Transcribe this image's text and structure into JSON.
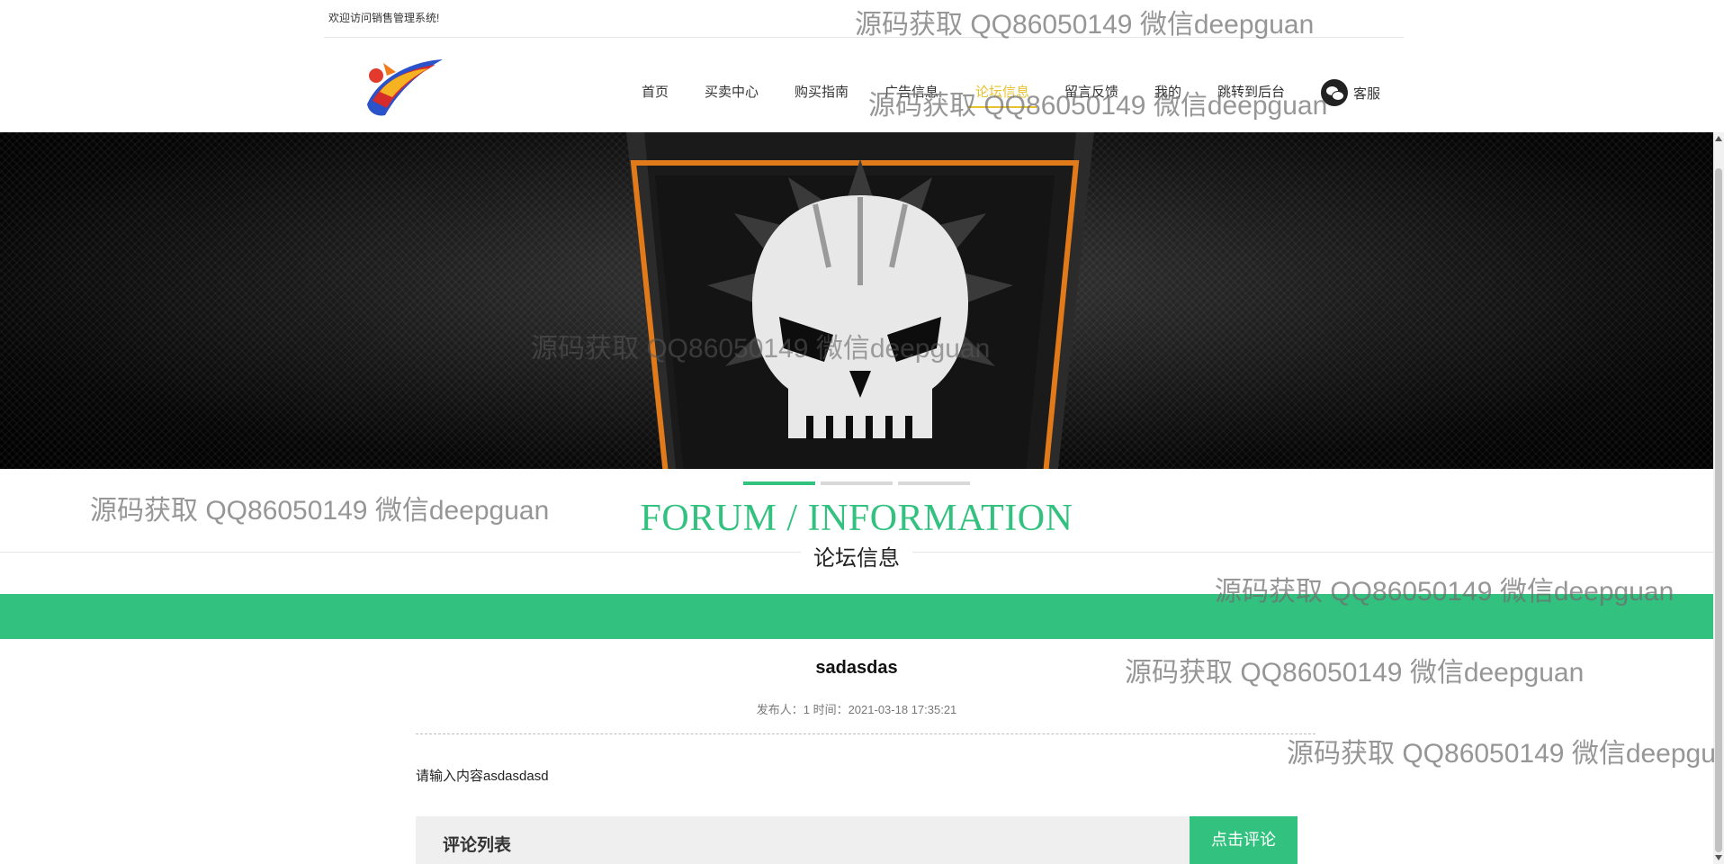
{
  "header": {
    "welcome": "欢迎访问销售管理系统!",
    "nav": [
      {
        "label": "首页",
        "name": "nav-home"
      },
      {
        "label": "买卖中心",
        "name": "nav-trade-center"
      },
      {
        "label": "购买指南",
        "name": "nav-buy-guide"
      },
      {
        "label": "广告信息",
        "name": "nav-ads"
      },
      {
        "label": "论坛信息",
        "name": "nav-forum",
        "active": true
      },
      {
        "label": "留言反馈",
        "name": "nav-feedback"
      },
      {
        "label": "我的",
        "name": "nav-mine"
      },
      {
        "label": "跳转到后台",
        "name": "nav-backend"
      }
    ],
    "service_label": "客服"
  },
  "banner": {
    "slides": 3,
    "active_slide": 1
  },
  "section": {
    "title_en": "FORUM / INFORMATION",
    "title_cn": "论坛信息"
  },
  "post": {
    "title": "sadasdas",
    "meta_author_label": "发布人：",
    "meta_author": "1",
    "meta_time_label": "时间：",
    "meta_time": "2021-03-18 17:35:21",
    "content": "请输入内容asdasdasd"
  },
  "comments": {
    "title": "评论列表",
    "button": "点击评论"
  },
  "watermarks": [
    "源码获取 QQ86050149 微信deepguan",
    "源码获取 QQ86050149 微信deepguan",
    "源码获取 QQ86050149 微信deepguan",
    "源码获取 QQ86050149 微信deepguan",
    "源码获取 QQ86050149 微信deepguan",
    "源码获取 QQ86050149 微信deepguan",
    "源码获取 QQ86050149 微信deepgu"
  ],
  "colors": {
    "accent_green": "#33c17f",
    "active_nav": "#e8c22c"
  }
}
